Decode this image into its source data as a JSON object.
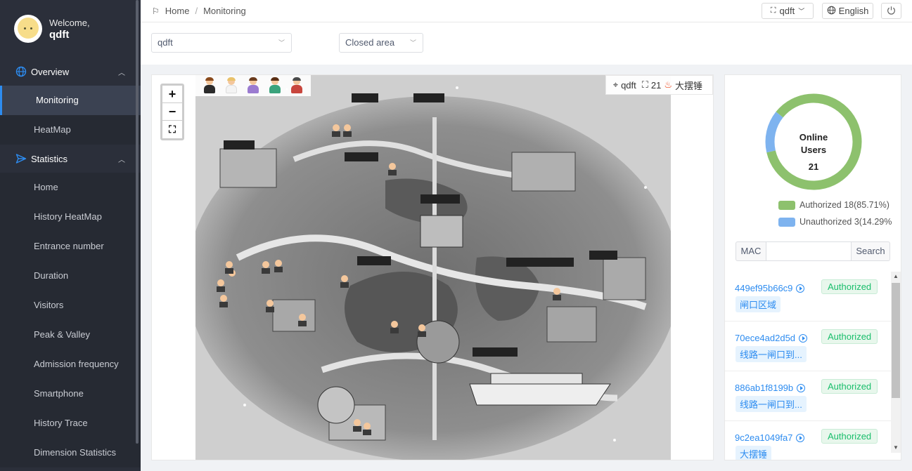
{
  "user": {
    "welcome": "Welcome,",
    "name": "qdft"
  },
  "sidebar": {
    "groups": [
      {
        "label": "Overview",
        "icon": "globe-icon",
        "items": [
          {
            "label": "Monitoring",
            "active": true
          },
          {
            "label": "HeatMap"
          }
        ]
      },
      {
        "label": "Statistics",
        "icon": "send-icon",
        "items": [
          {
            "label": "Home"
          },
          {
            "label": "History HeatMap"
          },
          {
            "label": "Entrance number"
          },
          {
            "label": "Duration"
          },
          {
            "label": "Visitors"
          },
          {
            "label": "Peak & Valley"
          },
          {
            "label": "Admission frequency"
          },
          {
            "label": "Smartphone"
          },
          {
            "label": "History Trace"
          },
          {
            "label": "Dimension Statistics"
          }
        ]
      }
    ]
  },
  "topbar": {
    "breadcrumb": [
      "Home",
      "Monitoring"
    ],
    "site_selector": "qdft",
    "language": "English"
  },
  "filters": {
    "site": "qdft",
    "area": "Closed area"
  },
  "map": {
    "zoom_in": "+",
    "zoom_out": "−",
    "info": {
      "site": "qdft",
      "count": "21",
      "area": "大摆锤"
    }
  },
  "stats": {
    "chart_data": {
      "type": "pie",
      "title": "Online Users",
      "total": 21,
      "series": [
        {
          "name": "Authorized 18(85.71%)",
          "value": 18,
          "color": "#8dc16d"
        },
        {
          "name": "Unauthorized 3(14.29%)",
          "value": 3,
          "color": "#7eb3ef"
        }
      ]
    },
    "title_line1": "Online",
    "title_line2": "Users",
    "total_label": "21",
    "legend_authorized": "Authorized 18(85.71%)",
    "legend_unauthorized": "Unauthorized 3(14.29%"
  },
  "search": {
    "addon": "MAC",
    "placeholder": "",
    "button": "Search"
  },
  "devices": [
    {
      "mac": "449ef95b66c9",
      "status": "Authorized",
      "zone": "闸口区域"
    },
    {
      "mac": "70ece4ad2d5d",
      "status": "Authorized",
      "zone": "线路一闸口到..."
    },
    {
      "mac": "886ab1f8199b",
      "status": "Authorized",
      "zone": "线路一闸口到..."
    },
    {
      "mac": "9c2ea1049fa7",
      "status": "Authorized",
      "zone": "大摆锤"
    }
  ]
}
